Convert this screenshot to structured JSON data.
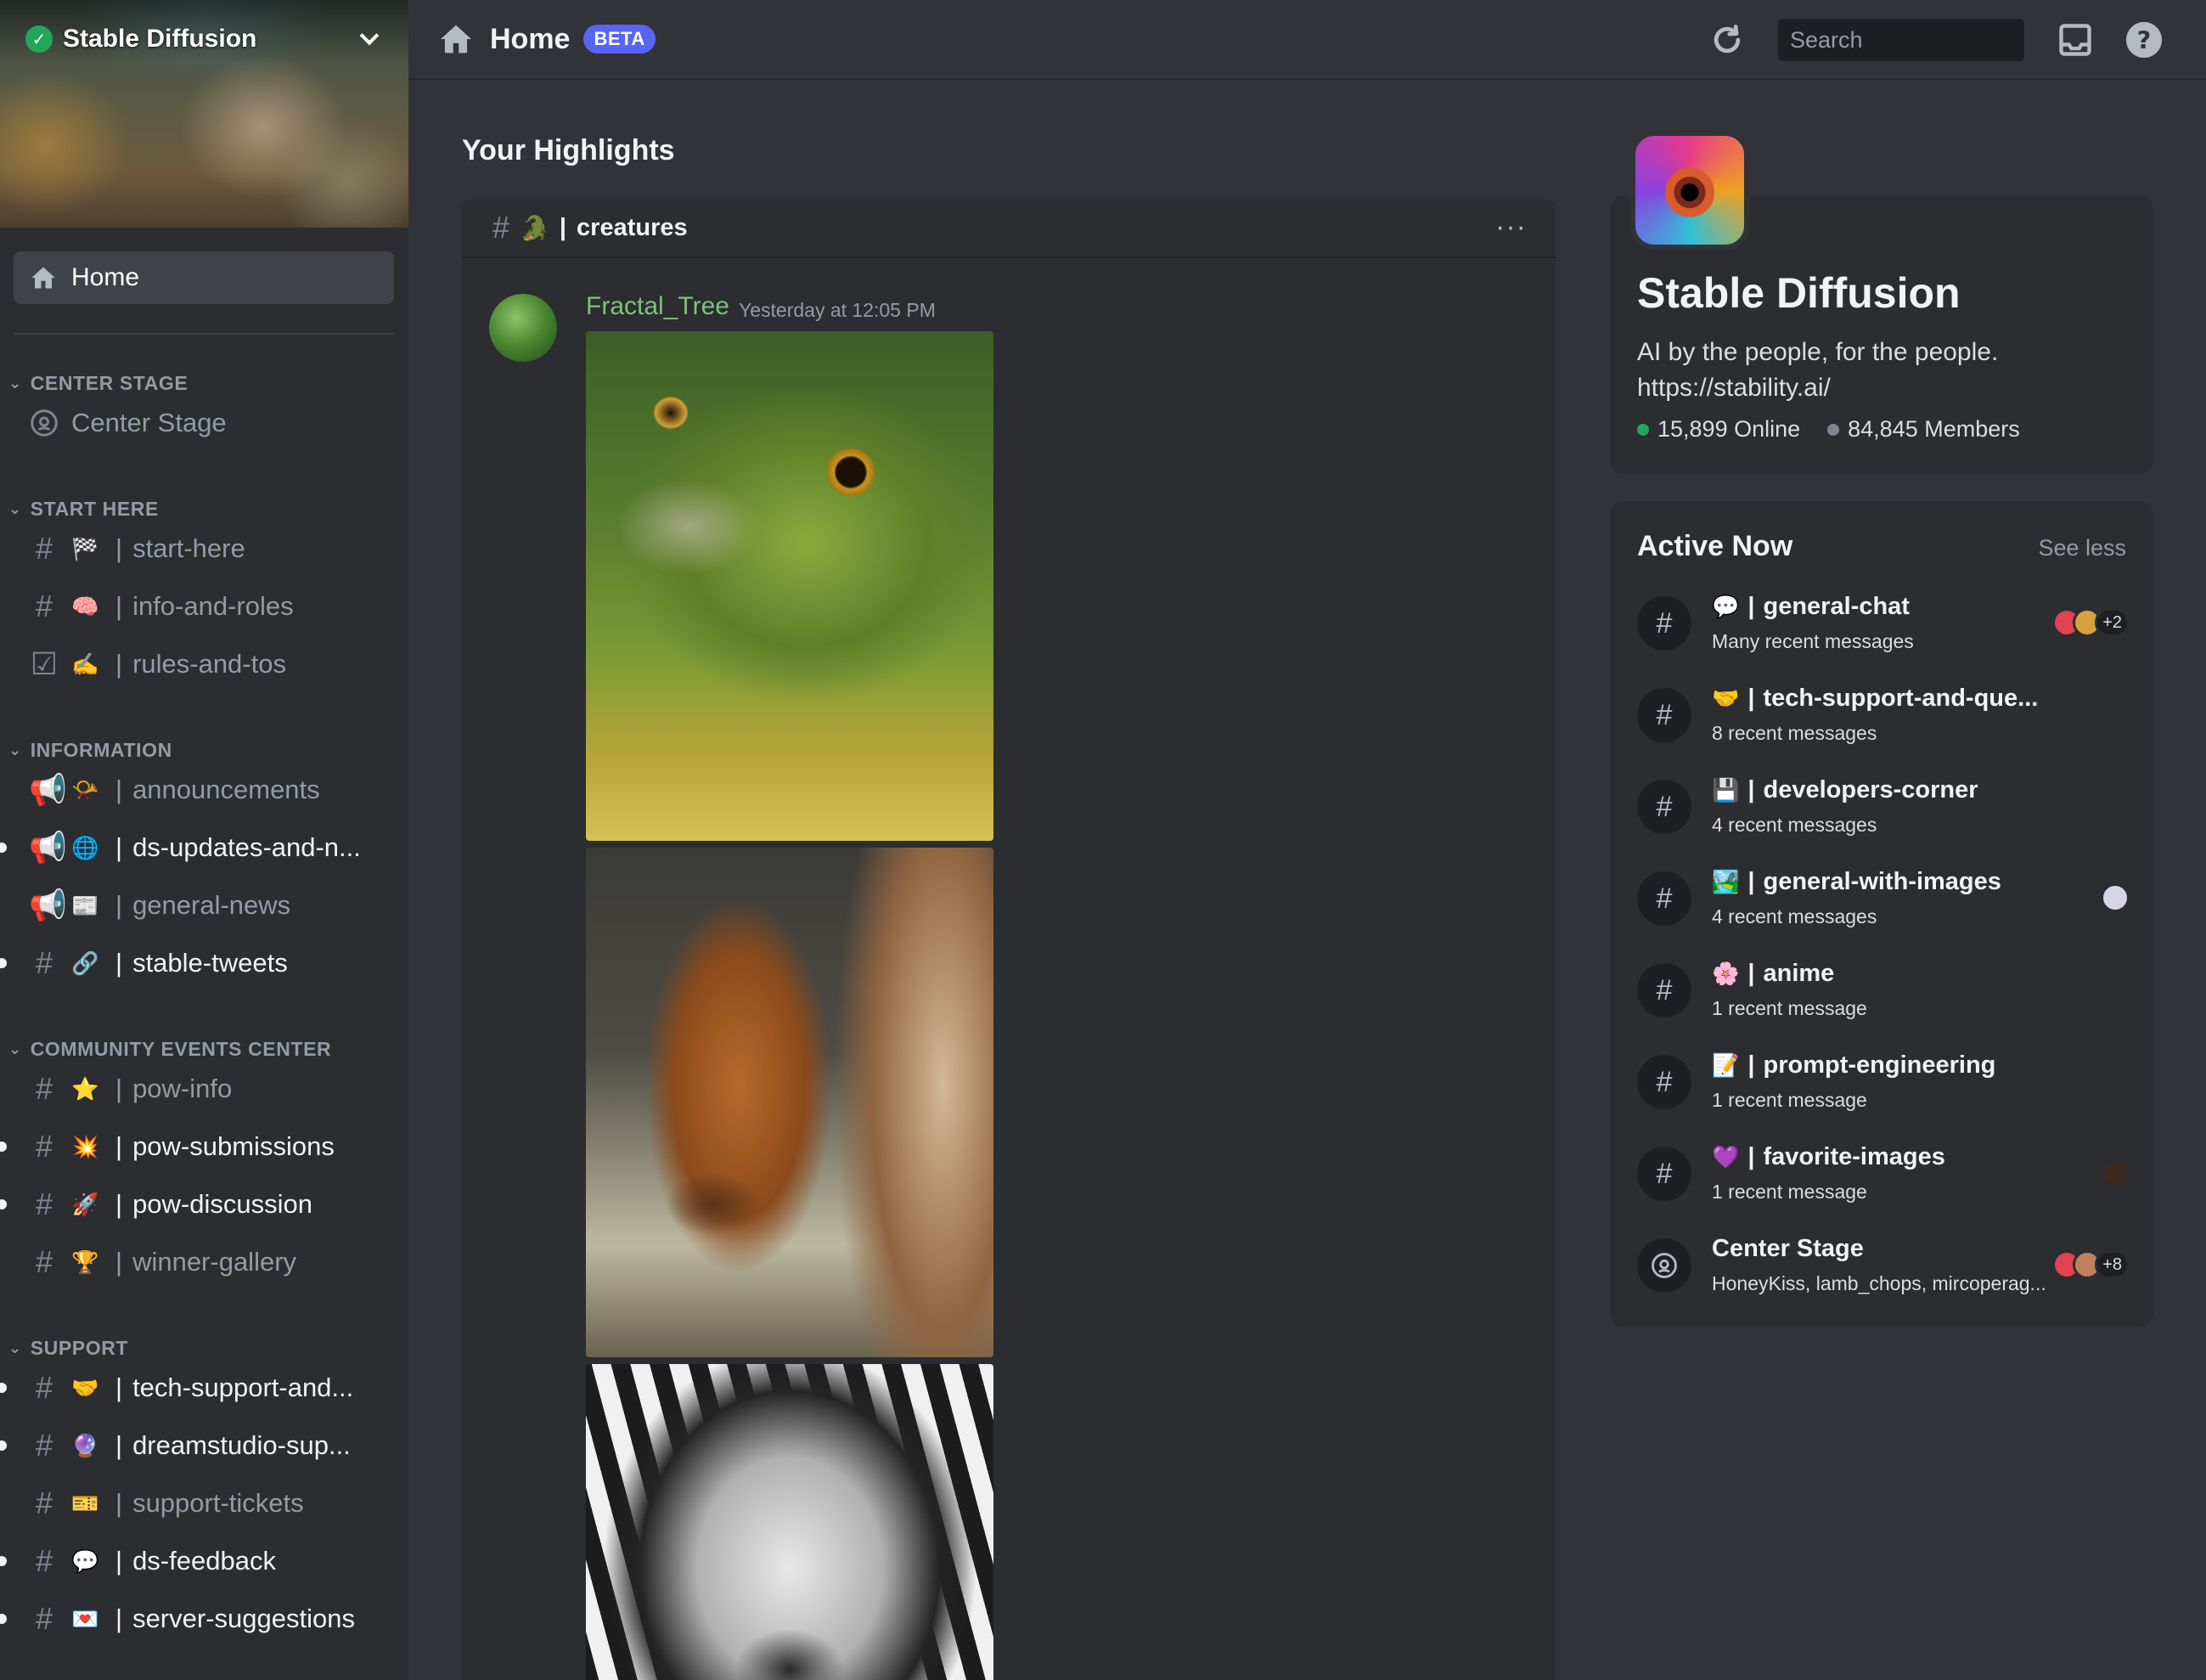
{
  "server": {
    "name": "Stable Diffusion"
  },
  "sidebar": {
    "home_label": "Home",
    "categories": [
      {
        "label": "CENTER STAGE",
        "channels": [
          {
            "name": "Center Stage",
            "type": "stage",
            "emoji": "",
            "unread": false
          }
        ]
      },
      {
        "label": "START HERE",
        "channels": [
          {
            "name": "start-here",
            "type": "text",
            "emoji": "🏁",
            "unread": false
          },
          {
            "name": "info-and-roles",
            "type": "text",
            "emoji": "🧠",
            "unread": false
          },
          {
            "name": "rules-and-tos",
            "type": "rules",
            "emoji": "✍️",
            "unread": false
          }
        ]
      },
      {
        "label": "INFORMATION",
        "channels": [
          {
            "name": "announcements",
            "type": "announce",
            "emoji": "📯",
            "unread": false
          },
          {
            "name": "ds-updates-and-n...",
            "type": "announce",
            "emoji": "🌐",
            "unread": true
          },
          {
            "name": "general-news",
            "type": "announce",
            "emoji": "📰",
            "unread": false
          },
          {
            "name": "stable-tweets",
            "type": "text",
            "emoji": "🔗",
            "unread": true
          }
        ]
      },
      {
        "label": "COMMUNITY EVENTS CENTER",
        "channels": [
          {
            "name": "pow-info",
            "type": "text",
            "emoji": "⭐",
            "unread": false
          },
          {
            "name": "pow-submissions",
            "type": "text",
            "emoji": "💥",
            "unread": true
          },
          {
            "name": "pow-discussion",
            "type": "text",
            "emoji": "🚀",
            "unread": true
          },
          {
            "name": "winner-gallery",
            "type": "text",
            "emoji": "🏆",
            "unread": false
          }
        ]
      },
      {
        "label": "SUPPORT",
        "channels": [
          {
            "name": "tech-support-and...",
            "type": "text",
            "emoji": "🤝",
            "unread": true
          },
          {
            "name": "dreamstudio-sup...",
            "type": "text",
            "emoji": "🔮",
            "unread": true
          },
          {
            "name": "support-tickets",
            "type": "text",
            "emoji": "🎫",
            "unread": false
          },
          {
            "name": "ds-feedback",
            "type": "text",
            "emoji": "💬",
            "unread": true
          },
          {
            "name": "server-suggestions",
            "type": "text",
            "emoji": "💌",
            "unread": true
          }
        ]
      }
    ]
  },
  "topbar": {
    "title": "Home",
    "badge": "BETA",
    "search_placeholder": "Search"
  },
  "main": {
    "highlights_title": "Your Highlights",
    "feed": {
      "channel": "creatures",
      "channel_emoji": "🐊",
      "more": "···",
      "message": {
        "author": "Fractal_Tree",
        "timestamp": "Yesterday at 12:05 PM"
      }
    }
  },
  "right": {
    "server_card": {
      "name": "Stable Diffusion",
      "desc_line1": "AI by the people, for the people.",
      "desc_line2": "https://stability.ai/",
      "online": "15,899 Online",
      "members": "84,845 Members"
    },
    "active_now": {
      "title": "Active Now",
      "toggle": "See less",
      "items": [
        {
          "emoji": "💬",
          "name": "general-chat",
          "sub": "Many recent messages",
          "type": "text",
          "extra": "+2"
        },
        {
          "emoji": "🤝",
          "name": "tech-support-and-que...",
          "sub": "8 recent messages",
          "type": "text",
          "extra": ""
        },
        {
          "emoji": "💾",
          "name": "developers-corner",
          "sub": "4 recent messages",
          "type": "text",
          "extra": ""
        },
        {
          "emoji": "🏞️",
          "name": "general-with-images",
          "sub": "4 recent messages",
          "type": "text",
          "extra": ""
        },
        {
          "emoji": "🌸",
          "name": "anime",
          "sub": "1 recent message",
          "type": "text",
          "extra": ""
        },
        {
          "emoji": "📝",
          "name": "prompt-engineering",
          "sub": "1 recent message",
          "type": "text",
          "extra": ""
        },
        {
          "emoji": "💜",
          "name": "favorite-images",
          "sub": "1 recent message",
          "type": "text",
          "extra": ""
        },
        {
          "emoji": "",
          "name": "Center Stage",
          "sub": "HoneyKiss, lamb_chops, mircoperag...",
          "type": "stage",
          "extra": "+8"
        }
      ]
    }
  },
  "colors": {
    "accent": "#5865f2",
    "online": "#23a55a",
    "members": "#80848e",
    "author": "#7ec27a"
  }
}
